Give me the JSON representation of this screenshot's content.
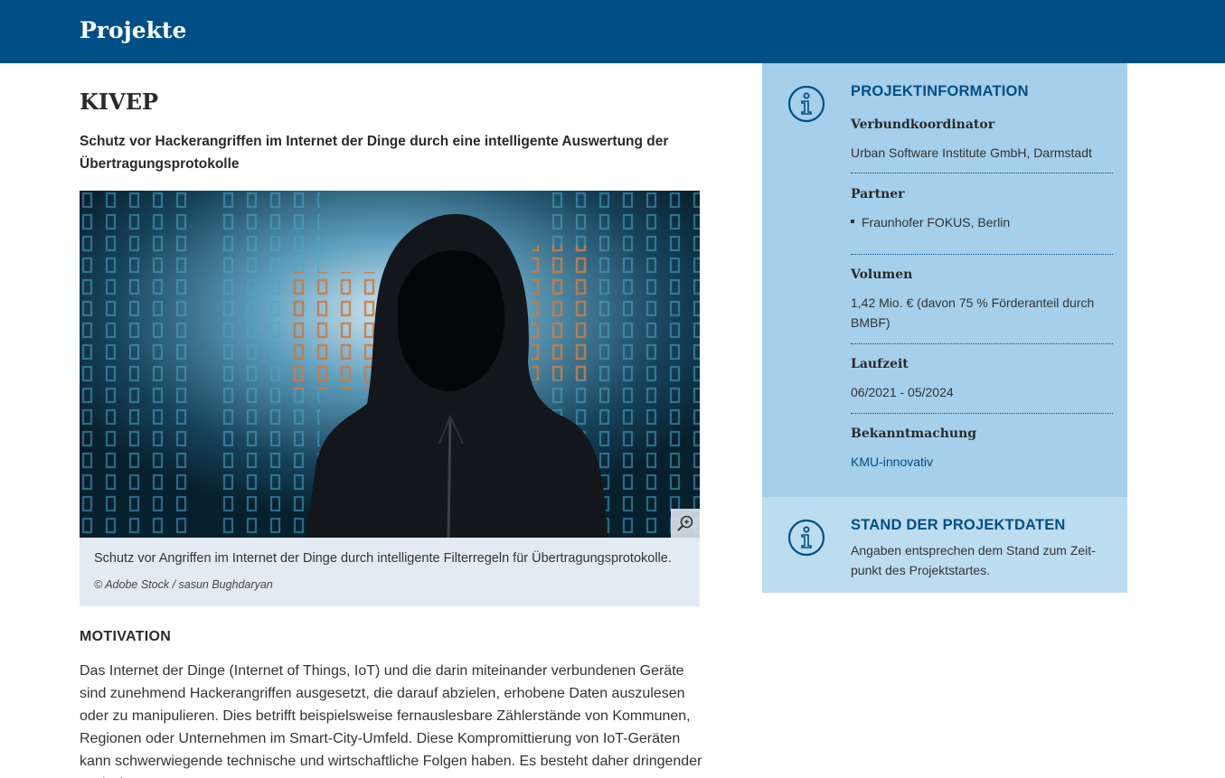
{
  "header": {
    "title": "Projekte"
  },
  "project": {
    "title": "KIVEP",
    "subtitle": "Schutz vor Hackerangriffen im Internet der Dinge durch eine intelligente Auswertung der Übertragungsprotokolle"
  },
  "figure": {
    "caption": "Schutz vor Angriffen im Internet der Dinge durch intelligente Filterregeln für Übertragungsprotokolle.",
    "credit": "© Adobe Stock / sasun Bughdaryan",
    "zoom_icon": "zoom-in-icon"
  },
  "motivation": {
    "heading": "MOTIVATION",
    "text": "Das Internet der Dinge (Internet of Things, IoT) und die darin miteinander verbundenen Geräte sind zunehmend Hackerangriffen ausgesetzt, die darauf abzielen, erhobene Daten auszulesen oder zu manipulieren. Dies betrifft beispielsweise fernauslesbare Zählerstände von Kommunen, Regionen oder Unternehmen im Smart-City-Umfeld. Diese Kompromittierung von IoT-Geräten kann schwerwiegende technische und wirtschaftliche Folgen haben. Es besteht daher dringender Bedarf"
  },
  "projektinfo": {
    "title": "PROJEKTINFORMATION",
    "icon": "info-icon",
    "coordinator_label": "Verbundkoordinator",
    "coordinator_value": "Urban Software Institute GmbH, Darmstadt",
    "partner_label": "Partner",
    "partners": [
      "Fraunhofer FOKUS, Berlin"
    ],
    "volume_label": "Volumen",
    "volume_value": "1,42 Mio. € (davon 75 % Förderanteil durch BMBF)",
    "runtime_label": "Laufzeit",
    "runtime_value": "06/2021 - 05/2024",
    "announcement_label": "Bekanntmachung",
    "announcement_value": "KMU-innovativ"
  },
  "stand": {
    "title": "STAND DER PROJEKTDATEN",
    "icon": "info-icon",
    "text": "Angaben entsprechen dem Stand zum Zeit-punkt des Projektstartes."
  },
  "colors": {
    "brand_blue": "#004f86",
    "panel_blue": "#a5cfea",
    "panel_light": "#bcdcf0",
    "caption_bg": "#e2ebf3"
  }
}
